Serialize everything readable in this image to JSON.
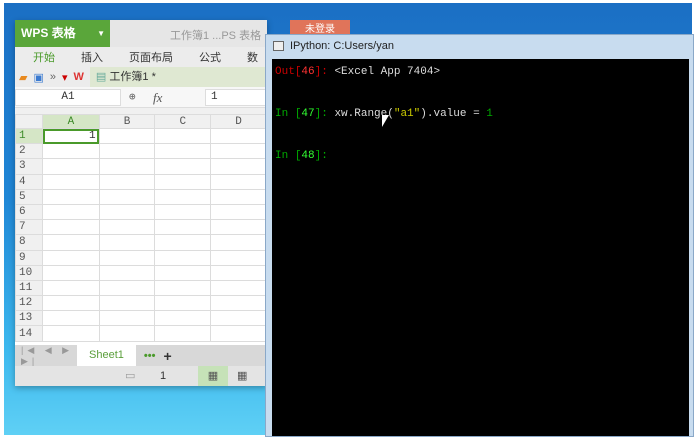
{
  "wps": {
    "app_name": "WPS 表格",
    "doc_title": "工作簿1 ...PS 表格",
    "login": "未登录",
    "menu": [
      "开始",
      "插入",
      "页面布局",
      "公式",
      "数"
    ],
    "doc_tab": "工作簿1 *",
    "name_box": "A1",
    "fx": "fx",
    "formula_value": "1",
    "columns": [
      "A",
      "B",
      "C",
      "D"
    ],
    "rows": [
      "1",
      "2",
      "3",
      "4",
      "5",
      "6",
      "7",
      "8",
      "9",
      "10",
      "11",
      "12",
      "13",
      "14"
    ],
    "cell_a1": "1",
    "sheet_tab": "Sheet1",
    "more": "•••",
    "add": "+",
    "status_page": "1"
  },
  "ipython": {
    "title": "IPython: C:Users/yan",
    "lines": [
      {
        "prompt": "Out",
        "num": "46",
        "rest": ": ",
        "code": "<Excel App 7404>"
      },
      {
        "prompt": "In ",
        "num": "47",
        "rest": ": ",
        "code1": "xw.Range(",
        "str": "\"a1\"",
        "code2": ").value = ",
        "numv": "1"
      },
      {
        "prompt": "In ",
        "num": "48",
        "rest": ":"
      }
    ]
  }
}
